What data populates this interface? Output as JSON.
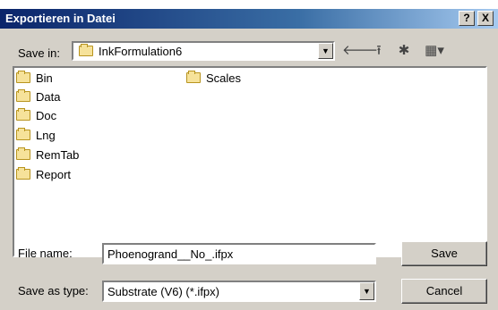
{
  "window": {
    "title": "Exportieren in Datei",
    "help_label": "?",
    "close_label": "X"
  },
  "save_in": {
    "label": "Save in:",
    "value": "InkFormulation6",
    "dropdown_icon": "chevron-down-icon"
  },
  "toolbar": {
    "icons": [
      "back-arrow-icon",
      "up-folder-icon",
      "new-folder-icon",
      "view-menu-icon"
    ]
  },
  "files": [
    {
      "name": "Bin",
      "icon": "folder-icon"
    },
    {
      "name": "Data",
      "icon": "folder-icon"
    },
    {
      "name": "Doc",
      "icon": "folder-icon"
    },
    {
      "name": "Lng",
      "icon": "folder-icon"
    },
    {
      "name": "RemTab",
      "icon": "folder-icon"
    },
    {
      "name": "Report",
      "icon": "folder-icon"
    },
    {
      "name": "Scales",
      "icon": "folder-icon"
    }
  ],
  "file_name": {
    "label": "File name:",
    "value": "Phoenogrand__No_.ifpx"
  },
  "save_as_type": {
    "label": "Save as type:",
    "value": "Substrate (V6) (*.ifpx)"
  },
  "buttons": {
    "save": "Save",
    "cancel": "Cancel"
  },
  "colors": {
    "titlebar_start": "#0a246a",
    "titlebar_end": "#a6caf0",
    "dialog_bg": "#d4d0c8",
    "folder": "#f6e29a"
  }
}
